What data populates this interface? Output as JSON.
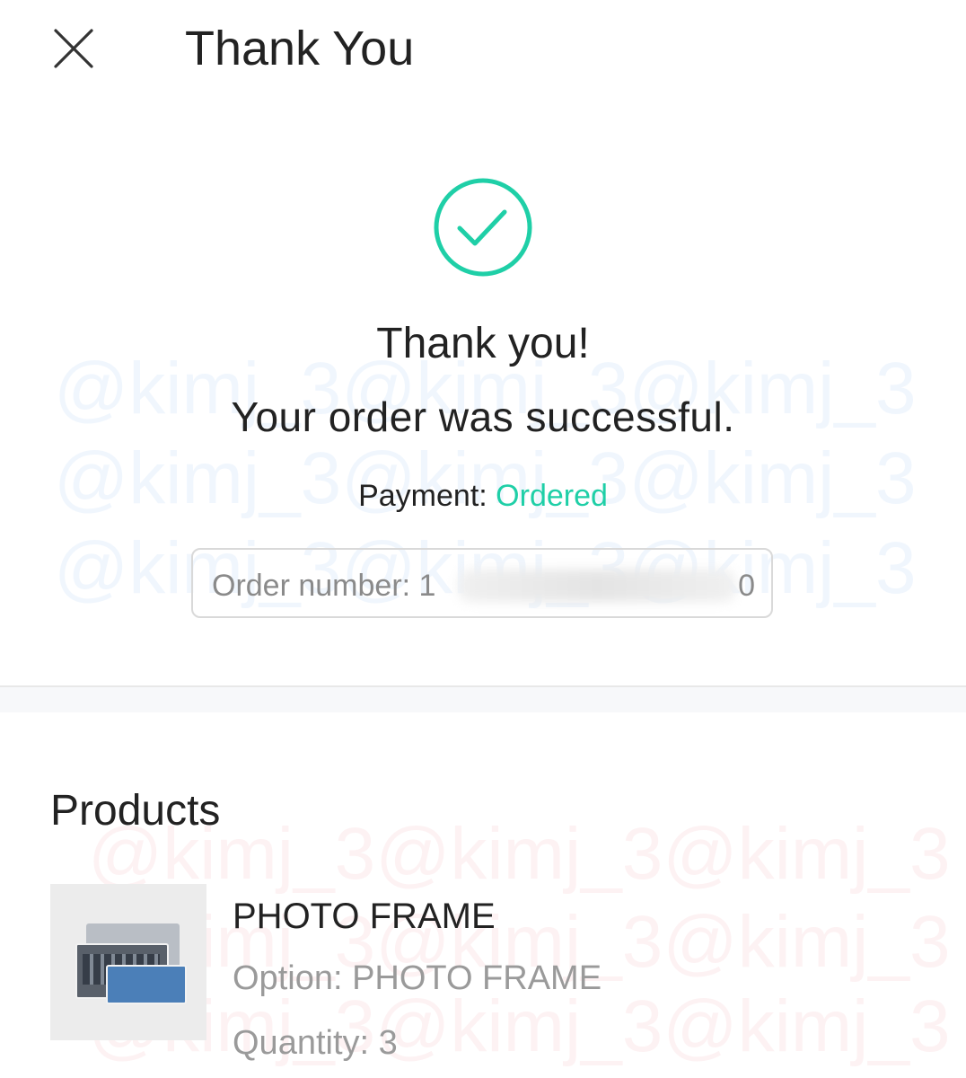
{
  "header": {
    "title": "Thank You",
    "close_icon": "close-icon"
  },
  "confirmation": {
    "icon": "check-circle-icon",
    "line1": "Thank you!",
    "line2": "Your order was successful.",
    "payment_label": "Payment: ",
    "payment_status": "Ordered",
    "order_label": "Order number: 1",
    "order_tail": "0"
  },
  "products": {
    "title": "Products",
    "items": [
      {
        "name": "PHOTO FRAME",
        "option": "Option: PHOTO FRAME",
        "quantity": "Quantity: 3"
      }
    ]
  },
  "watermark": {
    "text_rows": [
      "@kimj_3@kimj_3@kimj_3",
      "@kimj_3@kimj_3@kimj_3",
      "@kimj_3@kimj_3@kimj_3",
      "@kimj_3@kimj_3@kimj_3",
      "@kimj_3@kimj_3@kimj_3",
      "@kimj_3@kimj_3@kimj_3"
    ]
  },
  "colors": {
    "accent": "#1fcfa7",
    "text": "#222222",
    "muted": "#9a9a9a"
  }
}
